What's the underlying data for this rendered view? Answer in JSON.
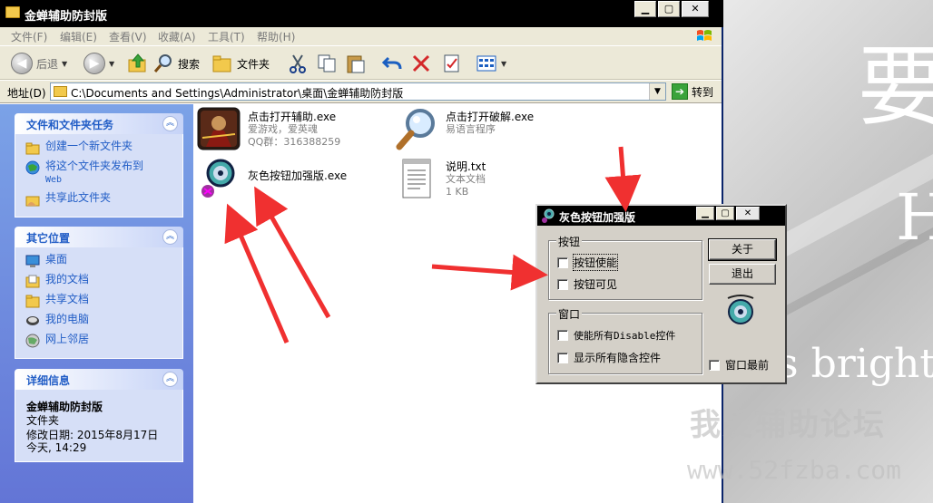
{
  "explorer": {
    "title": "金蝉辅助防封版",
    "menu": [
      "文件(F)",
      "编辑(E)",
      "查看(V)",
      "收藏(A)",
      "工具(T)",
      "帮助(H)"
    ],
    "toolbar": {
      "back": "后退",
      "search": "搜索",
      "folders": "文件夹"
    },
    "address": {
      "label": "地址(D)",
      "path": "C:\\Documents and Settings\\Administrator\\桌面\\金蝉辅助防封版",
      "go": "转到"
    },
    "tasks": {
      "title": "文件和文件夹任务",
      "items": [
        {
          "label": "创建一个新文件夹",
          "icon": "new-folder-icon"
        },
        {
          "label": "将这个文件夹发布到",
          "sub": "Web",
          "icon": "publish-web-icon"
        },
        {
          "label": "共享此文件夹",
          "icon": "share-folder-icon"
        }
      ]
    },
    "other_places": {
      "title": "其它位置",
      "items": [
        {
          "label": "桌面",
          "icon": "desktop-icon"
        },
        {
          "label": "我的文档",
          "icon": "my-documents-icon"
        },
        {
          "label": "共享文档",
          "icon": "shared-documents-icon"
        },
        {
          "label": "我的电脑",
          "icon": "my-computer-icon"
        },
        {
          "label": "网上邻居",
          "icon": "network-places-icon"
        }
      ]
    },
    "details": {
      "title": "详细信息",
      "name": "金蝉辅助防封版",
      "type": "文件夹",
      "modified": "修改日期: 2015年8月17日",
      "time": "今天, 14:29"
    },
    "files": [
      {
        "name": "点击打开辅助.exe",
        "meta1": "爱游戏，爱英魂",
        "meta2": "QQ群：316388259",
        "icon": "game-exe-icon"
      },
      {
        "name": "点击打开破解.exe",
        "meta1": "易语言程序",
        "meta2": "",
        "icon": "magnifier-exe-icon"
      },
      {
        "name": "灰色按钮加强版.exe",
        "meta1": "",
        "meta2": "",
        "icon": "disc-tool-exe-icon"
      },
      {
        "name": "说明.txt",
        "meta1": "文本文档",
        "meta2": "1 KB",
        "icon": "text-file-icon"
      }
    ]
  },
  "tool": {
    "title": "灰色按钮加强版",
    "button_group": "按钮",
    "enable_button": "按钮使能",
    "visible_button": "按钮可见",
    "window_group": "窗口",
    "enable_disabled": "使能所有Disable控件",
    "show_hidden": "显示所有隐含控件",
    "about": "关于",
    "exit": "退出",
    "topmost": "窗口最前"
  },
  "wallpaper": {
    "char1": "要",
    "char2": "H",
    "text": "s bright"
  },
  "watermark": {
    "cn": "我爱辅助论坛",
    "url": "www.52fzba.com"
  }
}
